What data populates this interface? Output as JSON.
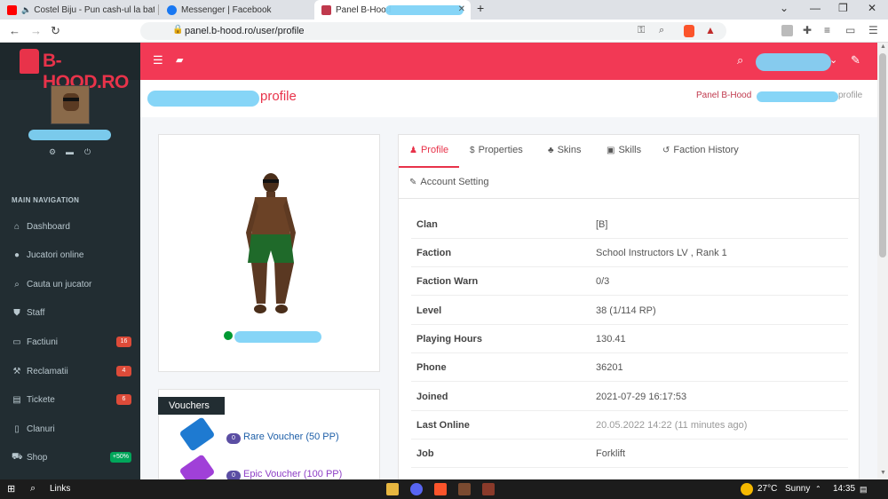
{
  "browser": {
    "tabs": [
      {
        "title": "Costel Biju - Pun cash-ul la bataie",
        "color": "#ff0000"
      },
      {
        "title": "Messenger | Facebook",
        "color": "#1877f2"
      },
      {
        "title": "Panel B-Hood",
        "color": "#c0394d"
      }
    ],
    "url": "panel.b-hood.ro/user/profile"
  },
  "sidebar": {
    "logo": "B-HOOD.RO",
    "nav_header": "MAIN NAVIGATION",
    "items": [
      {
        "label": "Dashboard",
        "icon": "home-icon",
        "glyph": "⌂"
      },
      {
        "label": "Jucatori online",
        "icon": "user-icon",
        "glyph": "●"
      },
      {
        "label": "Cauta un jucator",
        "icon": "search-icon",
        "glyph": "⌕"
      },
      {
        "label": "Staff",
        "icon": "shield-icon",
        "glyph": "⛊"
      },
      {
        "label": "Factiuni",
        "icon": "laptop-icon",
        "glyph": "▭",
        "badge": "16",
        "badge_color": "#dd4b39"
      },
      {
        "label": "Reclamatii",
        "icon": "gavel-icon",
        "glyph": "⚒",
        "badge": "4",
        "badge_color": "#dd4b39"
      },
      {
        "label": "Tickete",
        "icon": "id-card-icon",
        "glyph": "▤",
        "badge": "6",
        "badge_color": "#dd4b39"
      },
      {
        "label": "Clanuri",
        "icon": "file-icon",
        "glyph": "▯"
      },
      {
        "label": "Shop",
        "icon": "cart-icon",
        "glyph": "⛟",
        "badge": "+50%",
        "badge_color": "#00a65a"
      }
    ]
  },
  "header": {
    "title": "profile",
    "breadcrumb_left": "Panel B-Hood",
    "breadcrumb_right": "profile"
  },
  "profile_tabs": [
    {
      "label": "Profile",
      "glyph": "♟"
    },
    {
      "label": "Properties",
      "glyph": "$"
    },
    {
      "label": "Skins",
      "glyph": "♣"
    },
    {
      "label": "Skills",
      "glyph": "▣"
    },
    {
      "label": "Faction History",
      "glyph": "↺"
    },
    {
      "label": "Account Setting",
      "glyph": "✎"
    }
  ],
  "details": [
    {
      "key": "Clan",
      "value": "[B]"
    },
    {
      "key": "Faction",
      "value": "School Instructors LV , Rank 1"
    },
    {
      "key": "Faction Warn",
      "value": "0/3"
    },
    {
      "key": "Level",
      "value": "38 (1/114 RP)"
    },
    {
      "key": "Playing Hours",
      "value": "130.41"
    },
    {
      "key": "Phone",
      "value": "36201"
    },
    {
      "key": "Joined",
      "value": "2021-07-29 16:17:53"
    },
    {
      "key": "Last Online",
      "value": "20.05.2022 14:22 (11 minutes ago)"
    },
    {
      "key": "Job",
      "value": "Forklift"
    }
  ],
  "vouchers": {
    "title": "Vouchers",
    "items": [
      {
        "count": "0",
        "label": "Rare Voucher (50 PP)",
        "color": "#1e7ad1",
        "label_color": "#1e5fa8"
      },
      {
        "count": "0",
        "label": "Epic Voucher (100 PP)",
        "color": "#a040d8",
        "label_color": "#8e3fc6"
      }
    ]
  },
  "taskbar": {
    "links": "Links",
    "temp": "27°C",
    "weather": "Sunny",
    "time": "14:35"
  },
  "colors": {
    "accent": "#f23955",
    "sidebar_bg": "#222d32",
    "online": "#009933"
  }
}
